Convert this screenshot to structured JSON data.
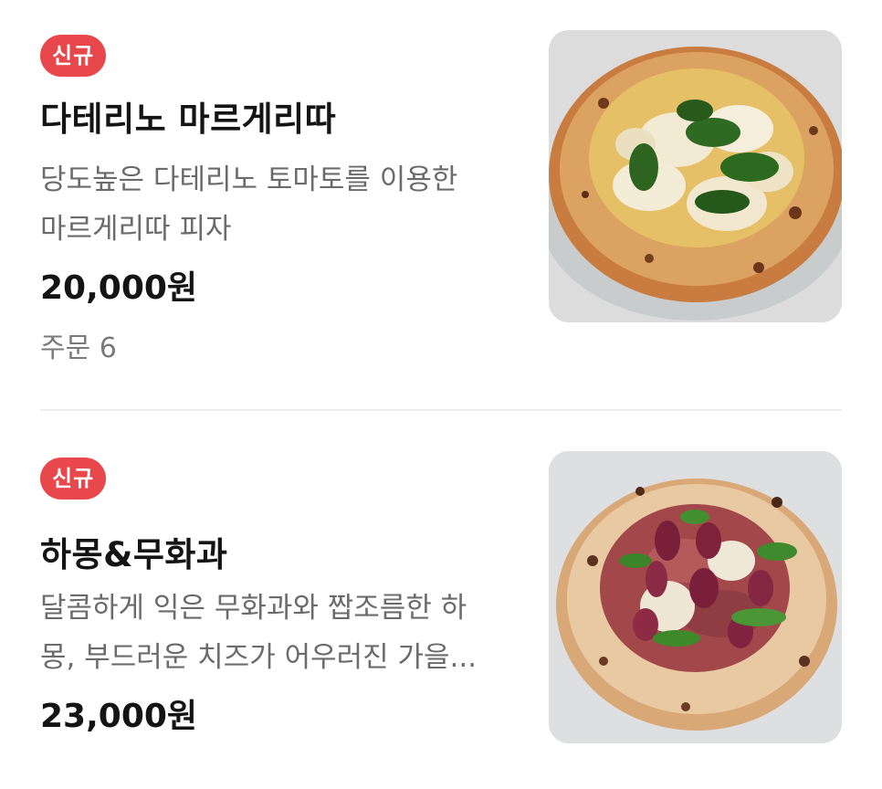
{
  "menu": {
    "items": [
      {
        "badge": "신규",
        "title": "다테리노 마르게리따",
        "description_lines": [
          "당도높은 다테리노 토마토를 이용한",
          "마르게리따 피자"
        ],
        "price": "20,000원",
        "orders": "주문 6",
        "image_icon": "margherita-pizza-photo"
      },
      {
        "badge": "신규",
        "title": "하몽&무화과",
        "description_lines": [
          "달콤하게 익은 무화과와 짭조름한 하",
          "몽, 부드러운 치즈가 어우러진 가을..."
        ],
        "price": "23,000원",
        "image_icon": "prosciutto-fig-pizza-photo"
      }
    ]
  },
  "colors": {
    "badge": "#e8474c",
    "title": "#141414",
    "description": "#6b6b6b",
    "divider": "#eeeeee"
  }
}
